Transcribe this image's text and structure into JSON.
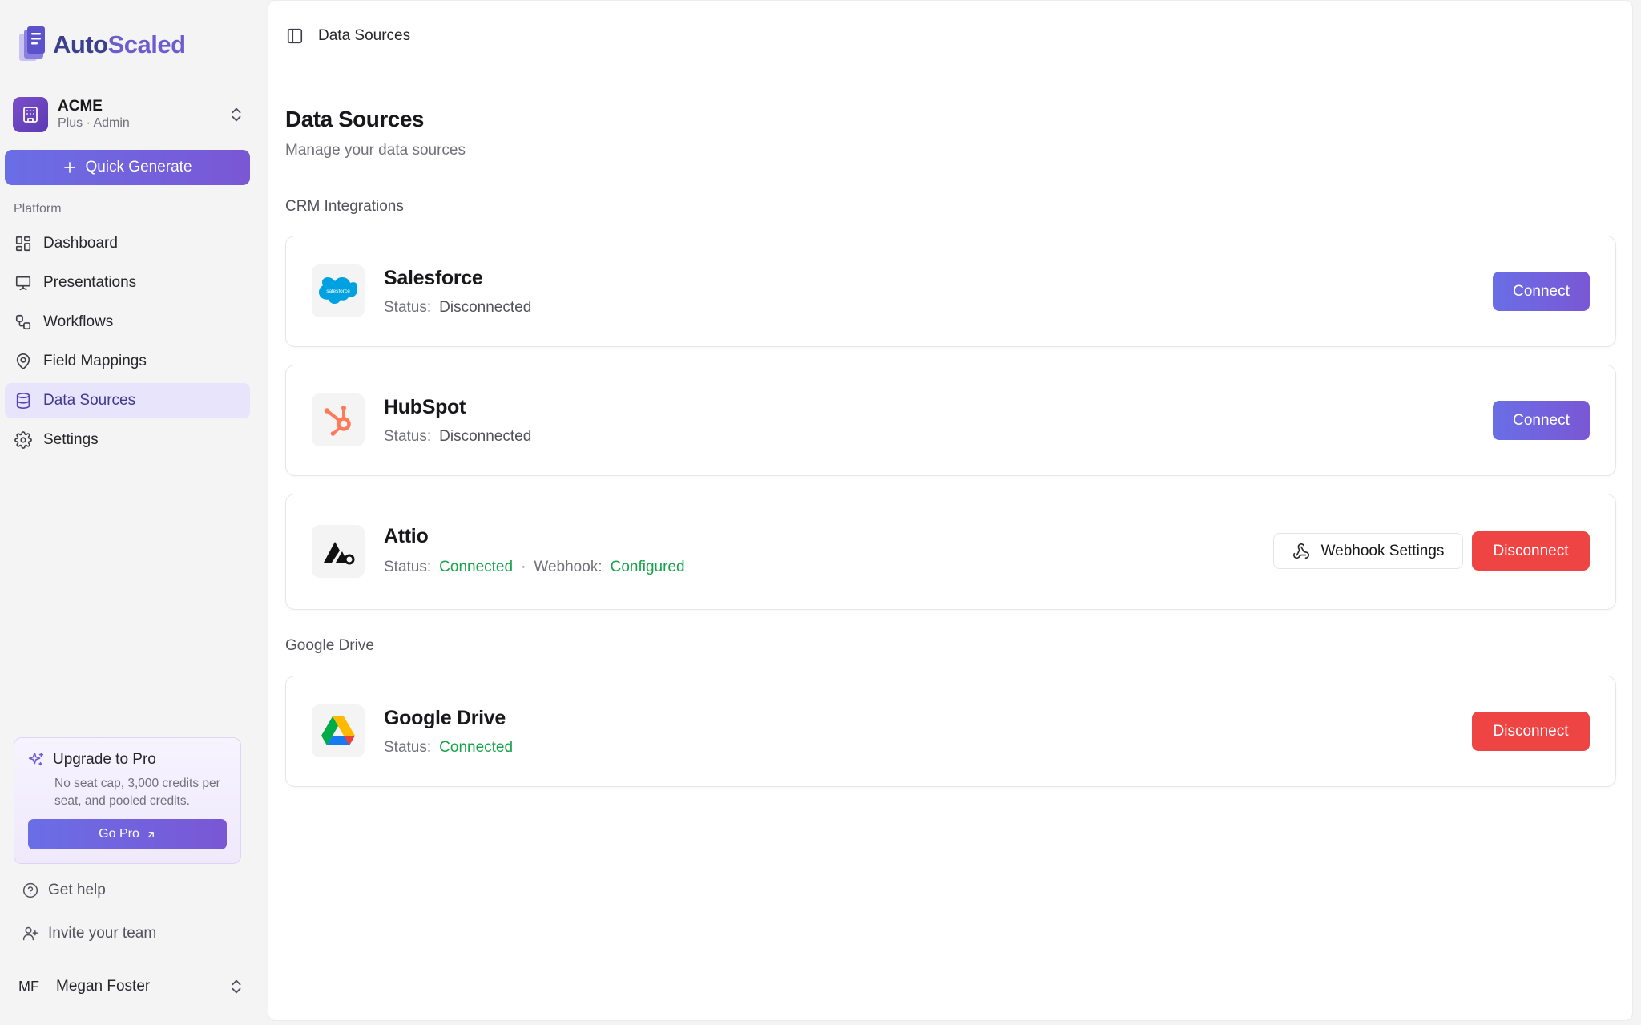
{
  "app": {
    "logo_auto": "Auto",
    "logo_scaled": "Scaled"
  },
  "org": {
    "name": "ACME",
    "role": "Plus · Admin"
  },
  "sidebar": {
    "quick_generate": "Quick Generate",
    "section_heading": "Platform",
    "items": [
      {
        "label": "Dashboard",
        "icon": "dashboard-icon"
      },
      {
        "label": "Presentations",
        "icon": "presentation-icon"
      },
      {
        "label": "Workflows",
        "icon": "workflow-icon"
      },
      {
        "label": "Field Mappings",
        "icon": "map-pin-icon"
      },
      {
        "label": "Data Sources",
        "icon": "database-icon",
        "active": true
      },
      {
        "label": "Settings",
        "icon": "gear-icon"
      }
    ],
    "upgrade": {
      "title": "Upgrade to Pro",
      "description": "No seat cap, 3,000 credits per seat, and pooled credits.",
      "button": "Go Pro"
    },
    "get_help": "Get help",
    "invite": "Invite your team",
    "user": {
      "initials": "MF",
      "name": "Megan Foster"
    }
  },
  "topbar": {
    "title": "Data Sources"
  },
  "page": {
    "title": "Data Sources",
    "subtitle": "Manage your data sources"
  },
  "sections": {
    "crm": "CRM Integrations",
    "drive": "Google Drive"
  },
  "status_label": "Status:",
  "webhook_label": "Webhook:",
  "integrations": {
    "salesforce": {
      "name": "Salesforce",
      "logo_text": "salesforce",
      "status": "Disconnected",
      "action": "Connect"
    },
    "hubspot": {
      "name": "HubSpot",
      "status": "Disconnected",
      "action": "Connect"
    },
    "attio": {
      "name": "Attio",
      "status": "Connected",
      "webhook": "Configured",
      "webhook_button": "Webhook Settings",
      "action": "Disconnect"
    },
    "gdrive": {
      "name": "Google Drive",
      "status": "Connected",
      "action": "Disconnect"
    }
  },
  "colors": {
    "accent_start": "#6a6ee6",
    "accent_end": "#7a57d4",
    "danger": "#ef4444",
    "success": "#16a34a",
    "active_nav_bg": "#e7e4fb"
  }
}
